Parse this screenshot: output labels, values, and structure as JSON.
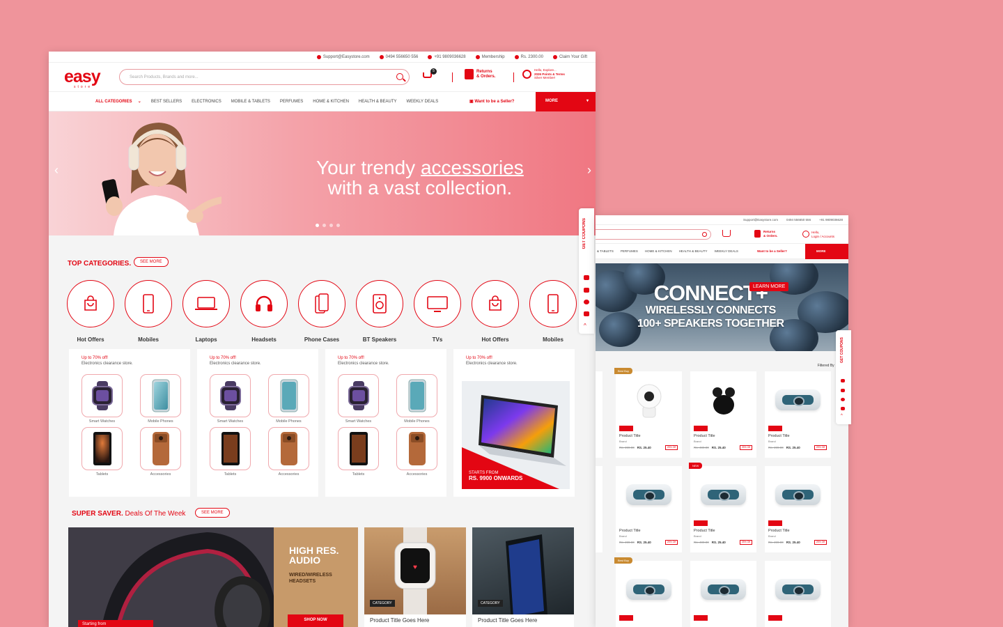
{
  "main": {
    "topbar": {
      "email": "Support@Easystore.com",
      "phone": "0494 556650 556",
      "whatsapp": "+91 9809036628",
      "membership": "Membership",
      "price": "Rs. 2300.00",
      "gift": "Claim Your Gift"
    },
    "logo": {
      "text": "easy",
      "sub": "store"
    },
    "search": {
      "placeholder": "Search Products, Brands and more..."
    },
    "cart_count": "5",
    "returns": {
      "line1": "Returns",
      "line2": "& Orders."
    },
    "user": {
      "line1": "Hello, Explore...",
      "line2": "2026 Points & Terms",
      "line3": "Silver Member!"
    },
    "nav": {
      "all_categories": "ALL CATEGORIES",
      "items": [
        "BEST SELLERS",
        "ELECTRONICS",
        "MOBILE & TABLETS",
        "PERFUMES",
        "HOME & KITCHEN",
        "HEALTH & BEAUTY",
        "WEEKLY DEALS"
      ],
      "seller": "Want to be a Seller?",
      "more": "MORE"
    },
    "hero": {
      "line1": "Your trendy ",
      "line1_bold": "accessories",
      "line2": "with a vast collection."
    },
    "top_categories": {
      "title": "TOP CATEGORIES.",
      "see_more": "SEE MORE",
      "items": [
        "Hot Offers",
        "Mobiles",
        "Laptops",
        "Headsets",
        "Phone Cases",
        "BT Speakers",
        "TVs",
        "Hot Offers",
        "Mobiles"
      ]
    },
    "promos": {
      "up_to": "Up to 70% off!",
      "subtitle": "Electronics clearance store.",
      "mini": [
        "Smart Watches",
        "Mobile Phones",
        "Tablets",
        "Accessories"
      ],
      "starts_from": "STARTS FROM",
      "price": "RS. 9900 ONWARDS"
    },
    "super_saver": {
      "title": "SUPER SAVER.",
      "subtitle": " Deals Of The Week",
      "see_more": "SEE MORE",
      "deal1": {
        "line1": "HIGH RES.",
        "line2": "AUDIO",
        "line3": "WIRED/WIRELESS",
        "line4": "HEADSETS",
        "shop": "SHOP NOW",
        "starting": "Starting from"
      },
      "deal2": {
        "category": "CATEGORY",
        "title": "Product Title Goes Here"
      },
      "deal3": {
        "category": "CATEGORY",
        "title": "Product Title Goes Here"
      }
    },
    "side_tab": "GET COUPONS"
  },
  "second": {
    "topbar": {
      "email": "Support@Easystore.com",
      "phone": "0494 556650 556",
      "whatsapp": "+91 9809036628"
    },
    "returns": {
      "line1": "Returns",
      "line2": "& Orders."
    },
    "user": {
      "line1": "Hello,",
      "line2": "Login / Accounts"
    },
    "nav": [
      "& TABLETS",
      "PERFUMES",
      "HOME & KITCHEN",
      "HEALTH & BEAUTY",
      "WEEKLY DEALS"
    ],
    "seller": "Want to be a Seller?",
    "more": "MORE",
    "banner": {
      "line1": "CONNECT+",
      "line2": "WIRELESSLY CONNECTS",
      "line3": "100+ SPEAKERS TOGETHER",
      "button": "LEARN MORE"
    },
    "filter": "Filtered By",
    "product": {
      "title": "Product Title",
      "brand": "Brand",
      "old_price": "Rs. 499.00",
      "price": "RS. 25.40",
      "off": "25% Off"
    },
    "flag_bestseller": "Best Buy",
    "flag_new": "NEW",
    "side_tab": "GET COUPONS"
  },
  "colors": {
    "accent": "#e30613",
    "background": "#ef949b"
  }
}
